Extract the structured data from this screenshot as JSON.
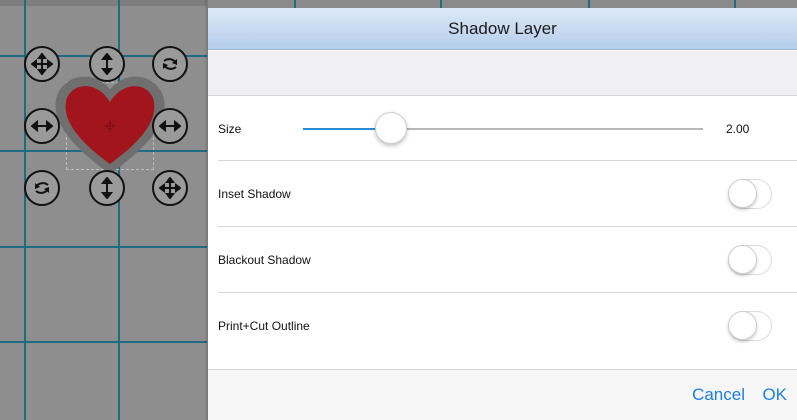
{
  "dialog": {
    "title": "Shadow Layer",
    "size": {
      "label": "Size",
      "value_text": "2.00",
      "fraction": 0.22
    },
    "toggles": [
      {
        "label": "Inset Shadow",
        "on": false
      },
      {
        "label": "Blackout Shadow",
        "on": false
      },
      {
        "label": "Print+Cut Outline",
        "on": false
      }
    ],
    "footer": {
      "cancel_label": "Cancel",
      "ok_label": "OK"
    }
  },
  "canvas": {
    "shape": "heart",
    "shape_color": "#a3151c",
    "handles": [
      "move-icon",
      "resize-vertical-icon",
      "rotate-icon",
      "resize-horizontal-icon",
      "resize-horizontal-icon",
      "rotate-icon",
      "resize-vertical-icon",
      "move-icon"
    ]
  },
  "colors": {
    "accent": "#1b7ee6",
    "grid_line": "#1e6b84",
    "title_bar": "#c7daf1"
  }
}
